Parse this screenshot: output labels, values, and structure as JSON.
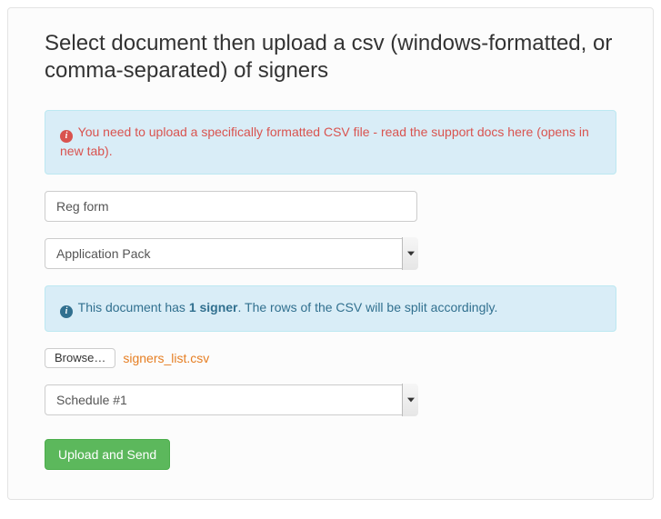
{
  "title": "Select document then upload a csv (windows-formatted, or comma-separated) of signers",
  "alert_upload": {
    "link_text": "You need to upload a specifically formatted CSV file - read the support docs here (opens in new tab)."
  },
  "title_input": {
    "value": "Reg form"
  },
  "document_select": {
    "selected": "Application Pack"
  },
  "alert_signer": {
    "pre": "This document has ",
    "count": "1 signer",
    "post": ". The rows of the CSV will be split accordingly."
  },
  "file": {
    "browse_label": "Browse…",
    "filename": "signers_list.csv"
  },
  "schedule_select": {
    "selected": "Schedule #1"
  },
  "submit_label": "Upload and Send"
}
